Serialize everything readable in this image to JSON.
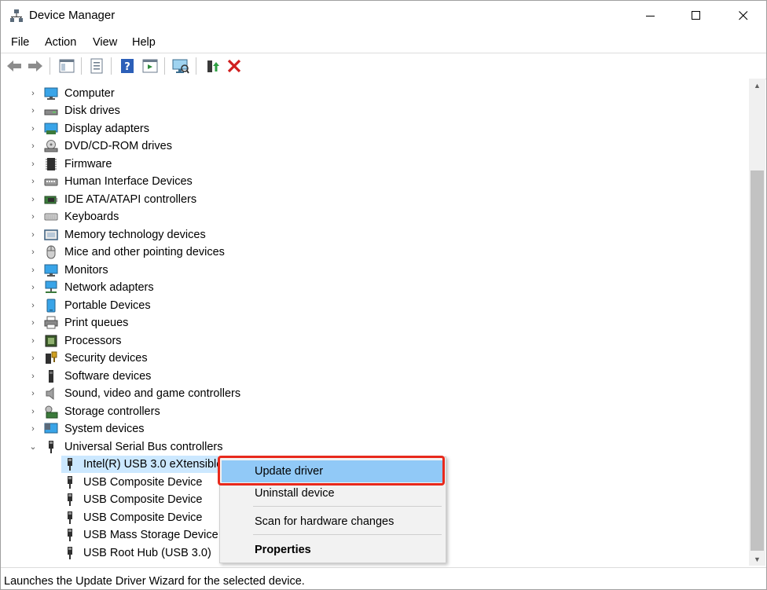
{
  "window": {
    "title": "Device Manager"
  },
  "menu": [
    "File",
    "Action",
    "View",
    "Help"
  ],
  "toolbar": {
    "buttons": [
      "back-icon",
      "forward-icon",
      "show-hide-console-tree-icon",
      "properties-icon",
      "help-icon",
      "update-driver-icon",
      "scan-hardware-icon",
      "enable-device-icon",
      "uninstall-device-icon"
    ]
  },
  "tree": {
    "categories": [
      "Computer",
      "Disk drives",
      "Display adapters",
      "DVD/CD-ROM drives",
      "Firmware",
      "Human Interface Devices",
      "IDE ATA/ATAPI controllers",
      "Keyboards",
      "Memory technology devices",
      "Mice and other pointing devices",
      "Monitors",
      "Network adapters",
      "Portable Devices",
      "Print queues",
      "Processors",
      "Security devices",
      "Software devices",
      "Sound, video and game controllers",
      "Storage controllers",
      "System devices",
      "Universal Serial Bus controllers"
    ],
    "usb_children": [
      "Intel(R) USB 3.0 eXtensible",
      "USB Composite Device",
      "USB Composite Device",
      "USB Composite Device",
      "USB Mass Storage Device",
      "USB Root Hub (USB 3.0)"
    ]
  },
  "context_menu": {
    "update_driver": "Update driver",
    "uninstall_device": "Uninstall device",
    "scan_hardware": "Scan for hardware changes",
    "properties": "Properties"
  },
  "status": {
    "text": "Launches the Update Driver Wizard for the selected device."
  },
  "colors": {
    "selection": "#cce8ff",
    "menu_highlight": "#91c9f7",
    "annotation_box": "#e8291c"
  }
}
